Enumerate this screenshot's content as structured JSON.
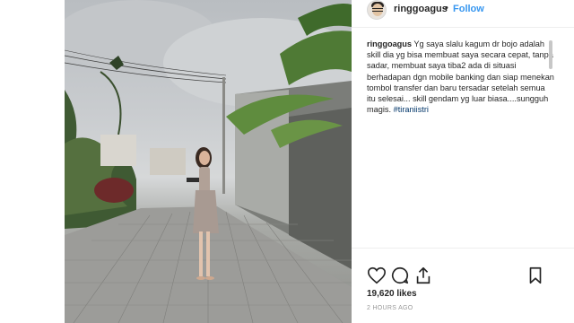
{
  "post": {
    "username": "ringgoagus",
    "separator": "•",
    "follow_label": "Follow",
    "caption": {
      "user": "ringgoagus",
      "text": "Yg saya slalu kagum dr bojo adalah skill dia yg bisa membuat saya secara cepat, tanpa sadar, membuat saya tiba2 ada di situasi berhadapan dgn mobile banking dan siap menekan tombol transfer dan baru tersadar setelah semua itu selesai... skill gendam yg luar biasa....sungguh magis.",
      "hashtag": "#tiraniistri"
    },
    "likes": "19,620 likes",
    "timestamp": "2 HOURS AGO"
  },
  "icons": {
    "like": "heart-icon",
    "comment": "comment-icon",
    "share": "share-icon",
    "save": "bookmark-icon",
    "verified": "verified-badge-icon"
  },
  "colors": {
    "accent": "#3897f0",
    "text": "#262626",
    "muted": "#999999"
  }
}
